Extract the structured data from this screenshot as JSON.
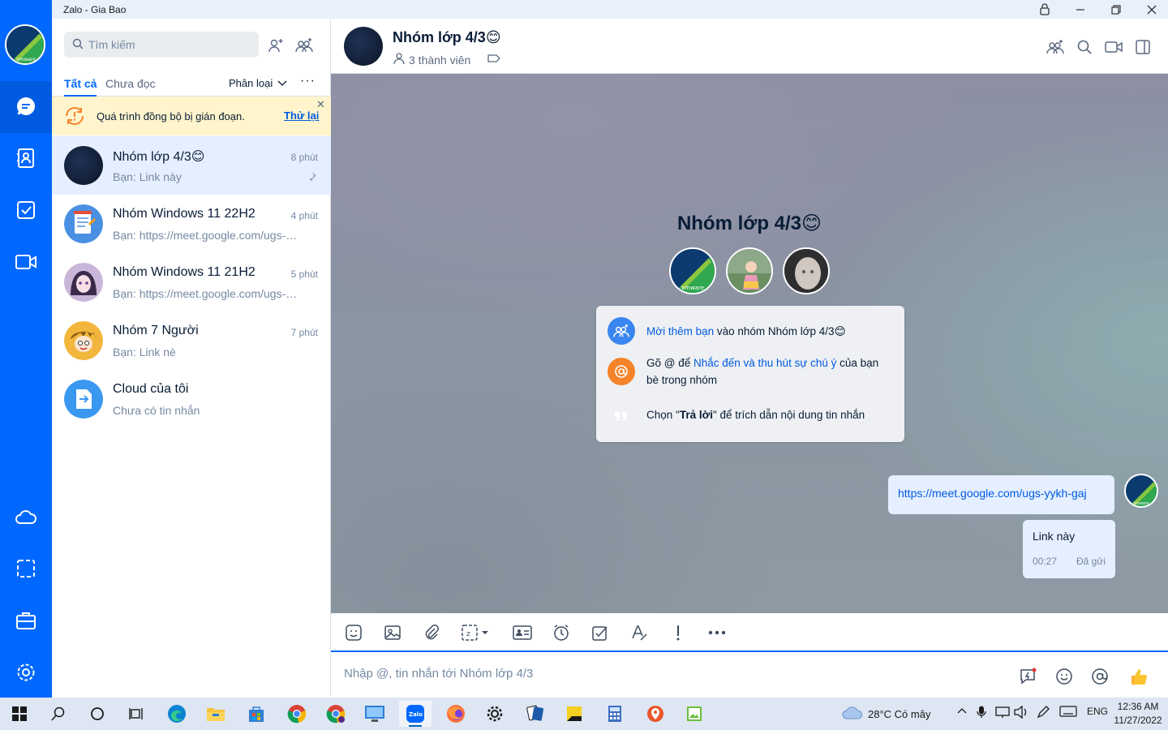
{
  "window": {
    "title": "Zalo - Gia Bao"
  },
  "nav": {
    "items": [
      {
        "name": "messages",
        "icon": "chat-bubble-icon",
        "active": true
      },
      {
        "name": "contacts",
        "icon": "contact-book-icon"
      },
      {
        "name": "todo",
        "icon": "checkbox-icon"
      },
      {
        "name": "video",
        "icon": "video-camera-icon"
      },
      {
        "name": "cloud",
        "icon": "cloud-icon"
      },
      {
        "name": "screenshot",
        "icon": "screen-capture-icon"
      },
      {
        "name": "tools",
        "icon": "briefcase-icon"
      },
      {
        "name": "settings",
        "icon": "gear-icon"
      }
    ]
  },
  "sidebar": {
    "search_placeholder": "Tìm kiếm",
    "tabs": {
      "all": "Tất cả",
      "unread": "Chưa đọc"
    },
    "classify": "Phân loại",
    "more": "···",
    "banner": {
      "text": "Quá trình đồng bộ bị gián đoạn.",
      "retry": "Thử lại",
      "close": "✕"
    },
    "conversations": [
      {
        "name": "Nhóm lớp 4/3",
        "emoji": "😊",
        "time": "8 phút",
        "message": "Bạn: Link này",
        "pinned": true,
        "active": true
      },
      {
        "name": "Nhóm Windows 11 22H2",
        "time": "4 phút",
        "message": "Bạn: https://meet.google.com/ugs-yykh-gaj"
      },
      {
        "name": "Nhóm Windows 11 21H2",
        "time": "5 phút",
        "message": "Bạn: https://meet.google.com/ugs-yykh-gaj"
      },
      {
        "name": "Nhóm 7 Người",
        "time": "7 phút",
        "message": "Bạn: Link nè"
      },
      {
        "name": "Cloud của tôi",
        "time": "",
        "message": "Chưa có tin nhắn"
      }
    ]
  },
  "chat": {
    "header": {
      "name": "Nhóm lớp 4/3",
      "emoji": "😊",
      "members": "3 thành viên"
    },
    "group_title": "Nhóm lớp 4/3",
    "info": {
      "invite_link": "Mời thêm bạn",
      "invite_rest": " vào nhóm Nhóm lớp 4/3",
      "mention_pre": "Gõ @ để ",
      "mention_link": "Nhắc đến và thu hút sự chú ý",
      "mention_rest": " của bạn bè trong nhóm",
      "reply_pre": "Chọn \"",
      "reply_bold": "Trả lời",
      "reply_rest": "\" để trích dẫn nội dung tin nhắn"
    },
    "messages": [
      {
        "type": "link",
        "text": "https://meet.google.com/ugs-yykh-gaj"
      },
      {
        "type": "text",
        "text": "Link này",
        "time": "00:27",
        "status": "Đã gửi"
      }
    ],
    "composer_placeholder": "Nhập @, tin nhắn tới Nhóm lớp 4/3"
  },
  "taskbar": {
    "weather": "28°C  Có mây",
    "lang": "ENG",
    "time": "12:36 AM",
    "date": "11/27/2022"
  },
  "colors": {
    "brand": "#0068ff",
    "banner": "#fff4cc",
    "bubble": "#e5efff"
  }
}
